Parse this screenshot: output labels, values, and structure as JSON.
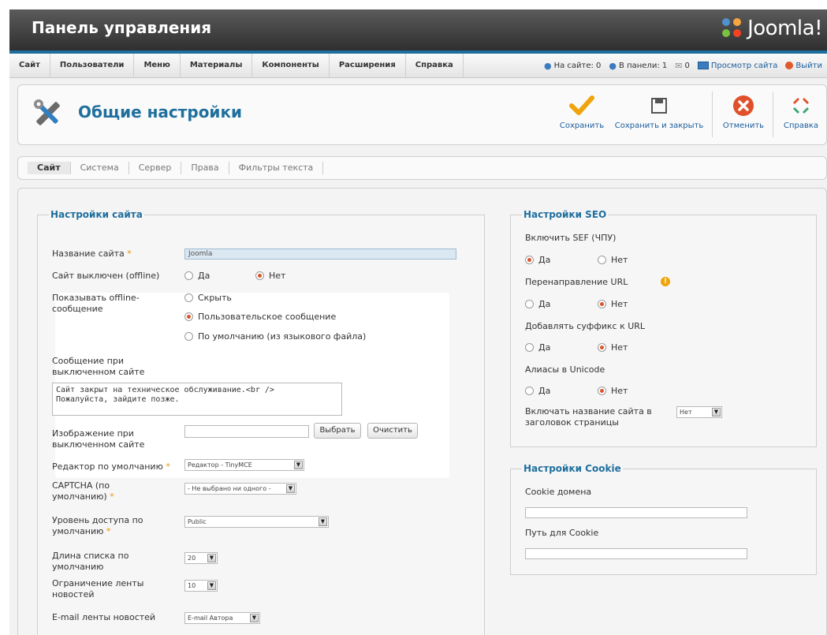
{
  "header": {
    "title": "Панель управления",
    "logo_text": "Joomla!"
  },
  "menu": [
    "Сайт",
    "Пользователи",
    "Меню",
    "Материалы",
    "Компоненты",
    "Расширения",
    "Справка"
  ],
  "status": {
    "on_site": "На сайте: 0",
    "in_panel": "В панели: 1",
    "messages": "0",
    "view_site": "Просмотр сайта",
    "logout": "Выйти"
  },
  "toolbar": {
    "title": "Общие настройки",
    "save": "Сохранить",
    "save_close": "Сохранить и закрыть",
    "cancel": "Отменить",
    "help": "Справка"
  },
  "tabs": [
    "Сайт",
    "Система",
    "Сервер",
    "Права",
    "Фильтры текста"
  ],
  "site": {
    "legend": "Настройки сайта",
    "site_name_label": "Название сайта",
    "site_name_value": "Joomla",
    "offline_label": "Сайт выключен (offline)",
    "offline_yes": "Да",
    "offline_no": "Нет",
    "show_offline_label": "Показывать offline-сообщение",
    "show_hide": "Скрыть",
    "show_custom": "Пользовательское сообщение",
    "show_default": "По умолчанию (из языкового файла)",
    "offline_message_label": "Сообщение при выключенном сайте",
    "offline_message_value": "Сайт закрыт на техническое обслуживание.<br />\nПожалуйста, зайдите позже.",
    "offline_image_label": "Изображение при выключенном сайте",
    "select_btn": "Выбрать",
    "clear_btn": "Очистить",
    "editor_label": "Редактор по умолчанию",
    "editor_value": "Редактор - TinyMCE",
    "captcha_label": "CAPTCHA (по умолчанию)",
    "captcha_value": "- Не выбрано ни одного -",
    "access_label": "Уровень доступа по умолчанию",
    "access_value": "Public",
    "list_length_label": "Длина списка по умолчанию",
    "list_length_value": "20",
    "feed_limit_label": "Ограничение ленты новостей",
    "feed_limit_value": "10",
    "feed_email_label": "E-mail ленты новостей",
    "feed_email_value": "E-mail Автора"
  },
  "seo": {
    "legend": "Настройки SEO",
    "sef_label": "Включить SEF (ЧПУ)",
    "rewrite_label": "Перенаправление URL",
    "suffix_label": "Добавлять суффикс к URL",
    "unicode_label": "Алиасы в Unicode",
    "sitename_label": "Включать название сайта в заголовок страницы",
    "sitename_value": "Нет",
    "yes": "Да",
    "no": "Нет"
  },
  "cookie": {
    "legend": "Настройки Cookie",
    "domain_label": "Cookie домена",
    "path_label": "Путь для Cookie"
  },
  "colors": {
    "accent": "#1f6f9e",
    "radio_on": "#d9552b",
    "required": "#e8950f"
  }
}
